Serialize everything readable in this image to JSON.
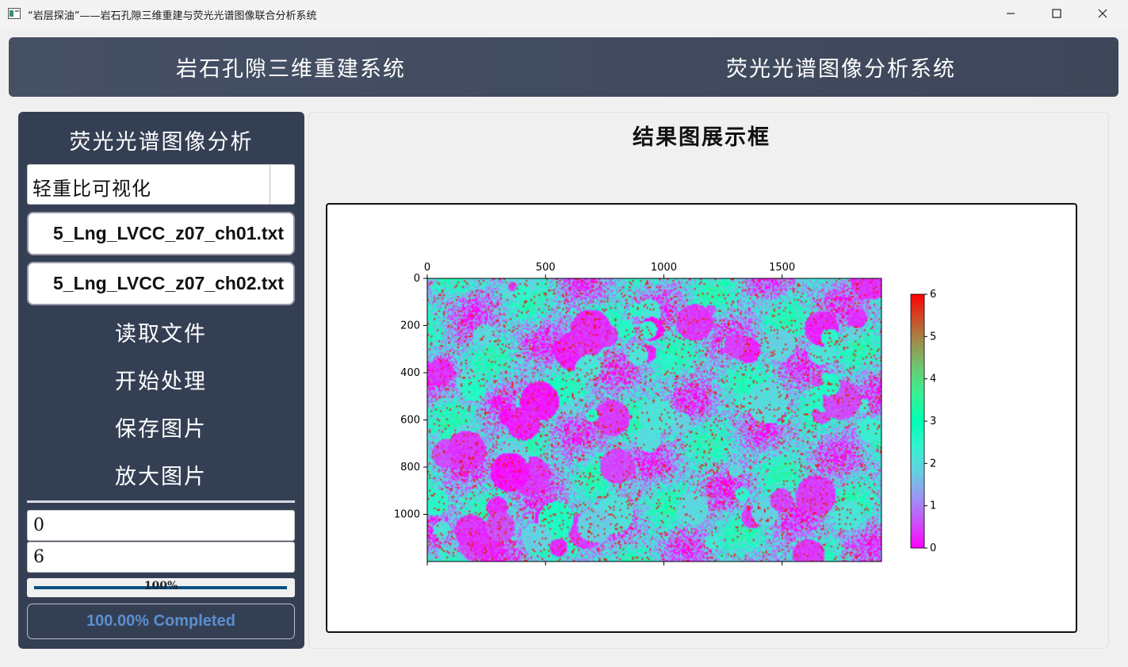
{
  "window": {
    "title": "“岩层探油”——岩石孔隙三维重建与荧光光谱图像联合分析系统",
    "controls": [
      "minimize-icon",
      "maximize-icon",
      "close-icon"
    ]
  },
  "nav": {
    "tabs": [
      {
        "label": "岩石孔隙三维重建系统"
      },
      {
        "label": "荧光光谱图像分析系统"
      }
    ]
  },
  "sidebar": {
    "title": "荧光光谱图像分析",
    "mode_select": {
      "value": "轻重比可视化"
    },
    "file1": "5_Lng_LVCC_z07_ch01.txt",
    "file2": "5_Lng_LVCC_z07_ch02.txt",
    "buttons": {
      "read": "读取文件",
      "process": "开始处理",
      "save": "保存图片",
      "zoom": "放大图片"
    },
    "min_value": "0",
    "max_value": "6",
    "progress": {
      "percent": 100,
      "label": "100%"
    },
    "status": "100.00% Completed"
  },
  "main": {
    "title": "结果图展示框"
  },
  "chart_data": {
    "type": "heatmap",
    "title": "",
    "xlabel": "",
    "ylabel": "",
    "x_ticks": [
      0,
      500,
      1000,
      1500
    ],
    "y_ticks": [
      0,
      200,
      400,
      600,
      800,
      1000
    ],
    "xlim": [
      0,
      1920
    ],
    "ylim": [
      1200,
      0
    ],
    "x_axis_position": "top",
    "colormap": "rainbow",
    "colorbar": {
      "min": 0,
      "max": 6,
      "ticks": [
        0,
        1,
        2,
        3,
        4,
        5,
        6
      ],
      "placement": "right"
    },
    "grid": false
  }
}
